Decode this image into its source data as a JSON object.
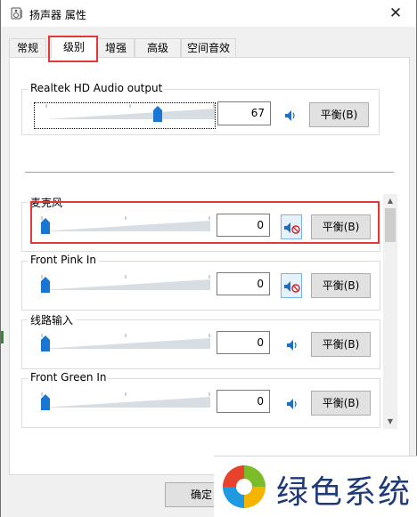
{
  "window": {
    "title": "扬声器 属性",
    "close_glyph": "✕"
  },
  "tabs": [
    {
      "label": "常规",
      "active": false
    },
    {
      "label": "级别",
      "active": true
    },
    {
      "label": "增强",
      "active": false
    },
    {
      "label": "高级",
      "active": false
    },
    {
      "label": "空间音效",
      "active": false
    }
  ],
  "master": {
    "name": "Realtek HD Audio output",
    "value": "67",
    "level": 0.67,
    "muted": false,
    "balance_label": "平衡(B)"
  },
  "channels": [
    {
      "name": "麦克风",
      "value": "0",
      "level": 0,
      "muted": true,
      "balance_label": "平衡(B)"
    },
    {
      "name": "Front Pink In",
      "value": "0",
      "level": 0,
      "muted": true,
      "balance_label": "平衡(B)"
    },
    {
      "name": "线路输入",
      "value": "0",
      "level": 0,
      "muted": false,
      "balance_label": "平衡(B)"
    },
    {
      "name": "Front Green In",
      "value": "0",
      "level": 0,
      "muted": false,
      "balance_label": "平衡(B)"
    }
  ],
  "buttons": {
    "ok_label": "确定"
  },
  "scrollbar": {
    "up_glyph": "▲",
    "down_glyph": "▼"
  },
  "watermark": {
    "text": "绿色系统"
  },
  "colors": {
    "highlight_red": "#e2383a",
    "slider_blue": "#1976d2",
    "watermark_blue": "#1e3a78"
  },
  "icons": {
    "title": "speaker-properties-icon",
    "speaker": "speaker-icon",
    "muted_speaker": "speaker-muted-icon",
    "logo": "windows-color-logo-icon"
  }
}
